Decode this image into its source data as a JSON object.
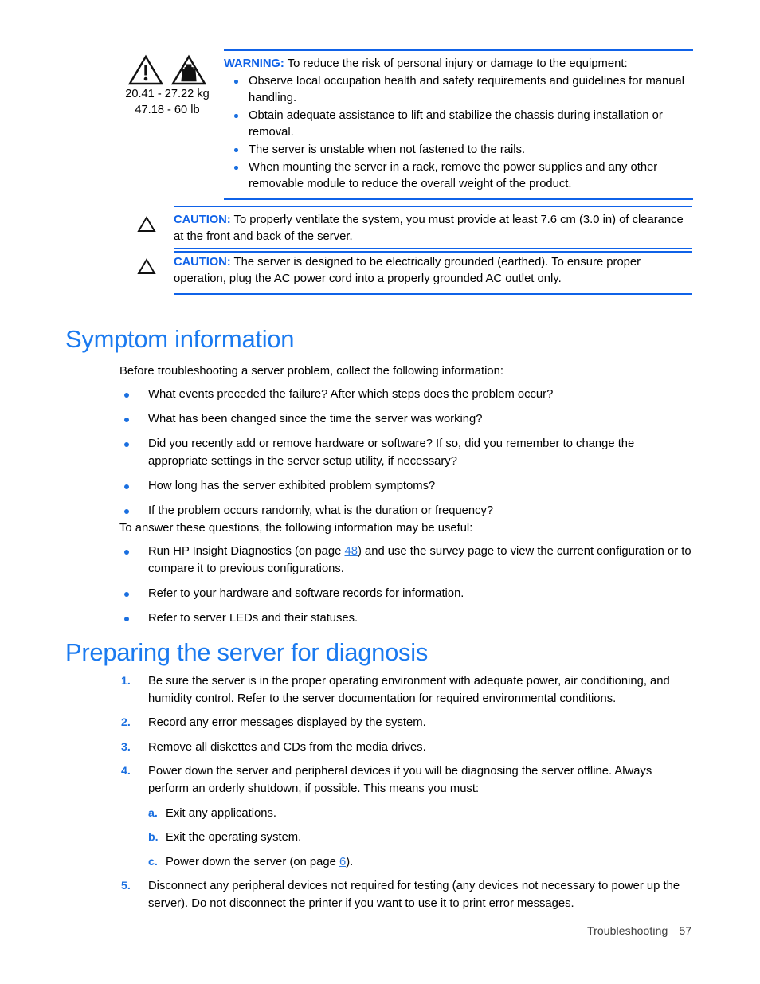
{
  "warning_block": {
    "icons": [
      "warning-triangle-exclamation-icon",
      "warning-triangle-weight-icon"
    ],
    "weight_kg": "20.41 - 27.22 kg",
    "weight_lb": "47.18 - 60 lb",
    "label": "WARNING:",
    "lead": "To reduce the risk of personal injury or damage to the equipment:",
    "items": [
      "Observe local occupation health and safety requirements and guidelines for manual handling.",
      "Obtain adequate assistance to lift and stabilize the chassis during installation or removal.",
      "The server is unstable when not fastened to the rails.",
      "When mounting the server in a rack, remove the power supplies and any other removable module to reduce the overall weight of the product."
    ]
  },
  "caution_1": {
    "icon": "caution-triangle-icon",
    "label": "CAUTION:",
    "text": "To properly ventilate the system, you must provide at least 7.6 cm (3.0 in) of clearance at the front and back of the server."
  },
  "caution_2": {
    "icon": "caution-triangle-icon",
    "label": "CAUTION:",
    "text": "The server is designed to be electrically grounded (earthed). To ensure proper operation, plug the AC power cord into a properly grounded AC outlet only."
  },
  "symptom_section": {
    "heading": "Symptom information",
    "intro": "Before troubleshooting a server problem, collect the following information:",
    "questions": [
      "What events preceded the failure? After which steps does the problem occur?",
      "What has been changed since the time the server was working?",
      "Did you recently add or remove hardware or software? If so, did you remember to change the appropriate settings in the server setup utility, if necessary?",
      "How long has the server exhibited problem symptoms?",
      "If the problem occurs randomly, what is the duration or frequency?"
    ],
    "answer_intro": "To answer these questions, the following information may be useful:",
    "resources": [
      {
        "before": "Run HP Insight Diagnostics (on page ",
        "link": "48",
        "after": ") and use the survey page to view the current configuration or to compare it to previous configurations."
      },
      {
        "before": "Refer to your hardware and software records for information.",
        "link": "",
        "after": ""
      },
      {
        "before": "Refer to server LEDs and their statuses.",
        "link": "",
        "after": ""
      }
    ]
  },
  "preparing_section": {
    "heading": "Preparing the server for diagnosis",
    "steps": [
      {
        "num": "1.",
        "text": "Be sure the server is in the proper operating environment with adequate power, air conditioning, and humidity control. Refer to the server documentation for required environmental conditions."
      },
      {
        "num": "2.",
        "text": "Record any error messages displayed by the system."
      },
      {
        "num": "3.",
        "text": "Remove all diskettes and CDs from the media drives."
      },
      {
        "num": "4.",
        "text": "Power down the server and peripheral devices if you will be diagnosing the server offline. Always perform an orderly shutdown, if possible. This means you must:"
      },
      {
        "num": "5.",
        "text": "Disconnect any peripheral devices not required for testing (any devices not necessary to power up the server). Do not disconnect the printer if you want to use it to print error messages."
      }
    ],
    "substeps": [
      {
        "num": "a.",
        "before": "Exit any applications.",
        "link": "",
        "after": ""
      },
      {
        "num": "b.",
        "before": "Exit the operating system.",
        "link": "",
        "after": ""
      },
      {
        "num": "c.",
        "before": "Power down the server (on page ",
        "link": "6",
        "after": ")."
      }
    ]
  },
  "footer": {
    "chapter": "Troubleshooting",
    "page": "57"
  },
  "colors": {
    "accent_blue": "#1a7af0",
    "rule_blue": "#0f62e8",
    "link_blue": "#2e7be0",
    "text_black": "#000000"
  }
}
